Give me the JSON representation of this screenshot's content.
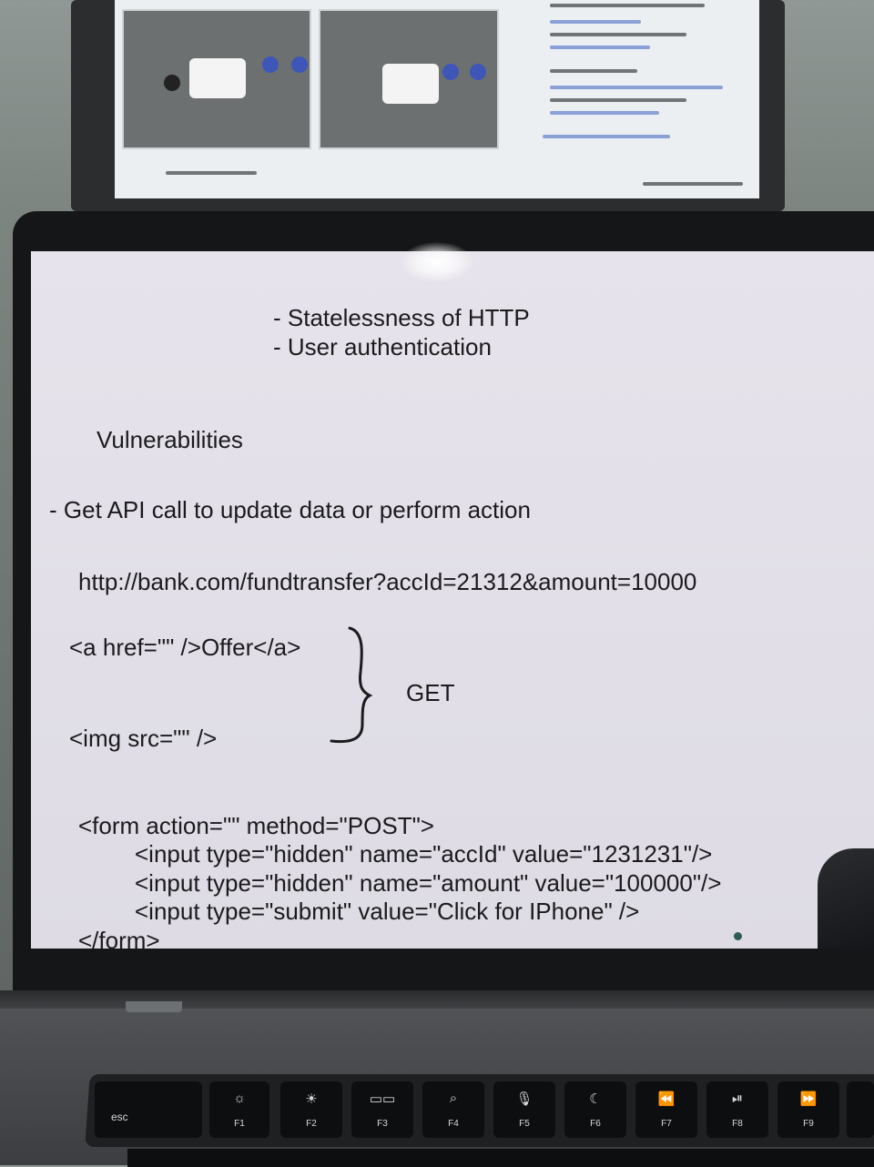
{
  "slide": {
    "bullets_top": [
      "- Statelessness of HTTP",
      "- User authentication"
    ],
    "heading": "Vulnerabilities",
    "point": "- Get API call to update data or perform action",
    "url": "http://bank.com/fundtransfer?accId=21312&amount=10000",
    "anchor_code": "<a href=\"\" />Offer</a>",
    "img_code": "<img src=\"\" />",
    "brace_label": "GET",
    "form_lines": [
      "<form action=\"\" method=\"POST\">",
      "<input type=\"hidden\" name=\"accId\" value=\"1231231\"/>",
      "<input type=\"hidden\" name=\"amount\" value=\"100000\"/>",
      "<input type=\"submit\" value=\"Click for IPhone\" />",
      "</form>"
    ]
  },
  "keyboard": {
    "function_keys": [
      {
        "name": "esc",
        "glyph": "",
        "label": "esc"
      },
      {
        "name": "f1",
        "glyph": "☼",
        "label": "F1"
      },
      {
        "name": "f2",
        "glyph": "☀",
        "label": "F2"
      },
      {
        "name": "f3",
        "glyph": "▭▭",
        "label": "F3"
      },
      {
        "name": "f4",
        "glyph": "⌕",
        "label": "F4"
      },
      {
        "name": "f5",
        "glyph": "🎙",
        "label": "F5"
      },
      {
        "name": "f6",
        "glyph": "☾",
        "label": "F6"
      },
      {
        "name": "f7",
        "glyph": "⏪",
        "label": "F7"
      },
      {
        "name": "f8",
        "glyph": "⏯",
        "label": "F8"
      },
      {
        "name": "f9",
        "glyph": "⏩",
        "label": "F9"
      }
    ]
  }
}
